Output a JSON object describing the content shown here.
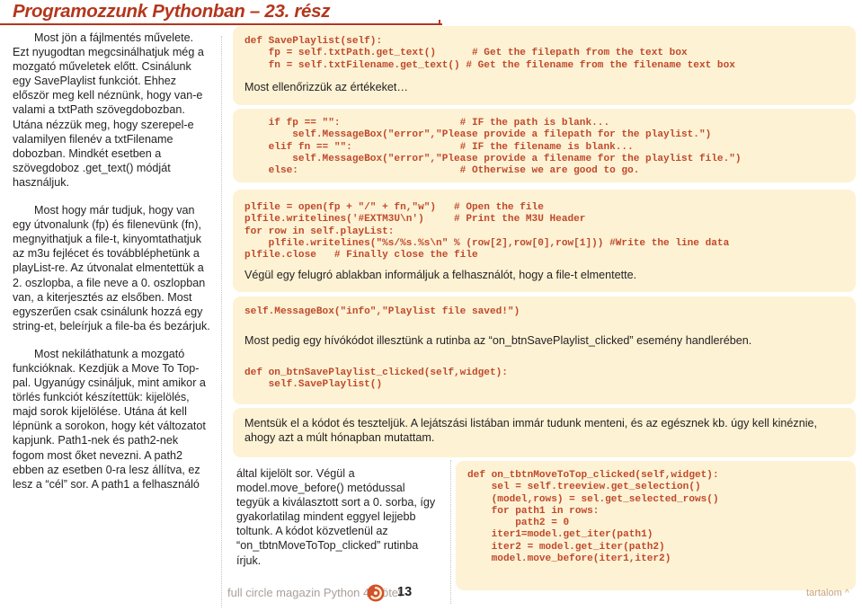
{
  "header": {
    "title": "Programozzunk Pythonban – 23. rész",
    "accent_color": "#b5361c"
  },
  "colors": {
    "code_panel_bg": "#fdf2d4",
    "code_text": "#c0492b",
    "body_text": "#231f20",
    "footer_muted": "#a9a19a",
    "toc_link": "#c9a27a"
  },
  "column_one": {
    "paragraphs": [
      "Most jön a fájlmentés művelete. Ezt nyugodtan megcsinálhatjuk még a mozgató műveletek előtt. Csinálunk egy SavePlaylist funkciót. Ehhez először meg kell néznünk, hogy van-e valami a txtPath szövegdobozban. Utána nézzük meg, hogy szerepel-e valamilyen filenév a txtFilename dobozban. Mindkét esetben a szövegdoboz .get_text() módját használjuk.",
      "Most hogy már tudjuk, hogy van egy útvonalunk (fp) és filenevünk (fn), megnyithatjuk a file-t, kinyomtathatjuk az m3u fejlécet és továbbléphetünk a playList-re. Az útvonalat elmentettük a 2. oszlopba, a file neve a 0. oszlopban van, a kiterjesztés az elsőben. Most egyszerűen csak csinálunk hozzá egy string-et, beleírjuk a file-ba és bezárjuk.",
      "Most nekiláthatunk a mozgató funkcióknak. Kezdjük a Move To Top-pal. Ugyanúgy csináljuk, mint amikor a törlés funkciót készítettük: kijelölés, majd sorok kijelölése. Utána át kell lépnünk a sorokon, hogy két változatot kapjunk. Path1-nek és path2-nek fogom most őket nevezni. A path2 ebben az esetben 0-ra lesz állítva, ez lesz a “cél” sor. A path1 a felhasználó"
    ]
  },
  "column_two": {
    "paragraph": "által kijelölt sor. Végül a model.move_before() metódussal tegyük a kiválasztott sort a 0. sorba, így gyakorlatilag mindent eggyel lejjebb toltunk. A kódot közvetlenül az “on_tbtnMoveToTop_clicked” rutinba írjuk."
  },
  "code_blocks": {
    "block1": "def SavePlaylist(self):\n    fp = self.txtPath.get_text()      # Get the filepath from the text box\n    fn = self.txtFilename.get_text() # Get the filename from the filename text box",
    "note1": "Most ellenőrizzük az értékeket…",
    "block2": "    if fp == \"\":                    # IF the path is blank...\n        self.MessageBox(\"error\",\"Please provide a filepath for the playlist.\")\n    elif fn == \"\":                  # IF the filename is blank...\n        self.MessageBox(\"error\",\"Please provide a filename for the playlist file.\")\n    else:                           # Otherwise we are good to go.",
    "block3": "plfile = open(fp + \"/\" + fn,\"w\")   # Open the file\nplfile.writelines('#EXTM3U\\n')     # Print the M3U Header\nfor row in self.playList:\n    plfile.writelines(\"%s/%s.%s\\n\" % (row[2],row[0],row[1])) #Write the line data\nplfile.close   # Finally close the file",
    "note2": "Végül egy felugró ablakban informáljuk a felhasználót, hogy a file-t elmentette.",
    "block4": "self.MessageBox(\"info\",\"Playlist file saved!\")",
    "note3": "Most pedig egy hívókódot illesztünk a rutinba az “on_btnSavePlaylist_clicked” esemény handlerében.",
    "block5": "def on_btnSavePlaylist_clicked(self,widget):\n    self.SavePlaylist()",
    "note4": "Mentsük el a kódot és teszteljük. A lejátszási listában immár tudunk menteni, és az egésznek kb. úgy kell kinéznie, ahogy azt a múlt hónapban mutattam.",
    "block6": "def on_tbtnMoveToTop_clicked(self,widget):\n    sel = self.treeview.get_selection()\n    (model,rows) = sel.get_selected_rows()\n    for path1 in rows:\n        path2 = 0\n    iter1=model.get_iter(path1)\n    iter2 = model.get_iter(path2)\n    model.move_before(iter1,iter2)"
  },
  "footer": {
    "magazine": "full circle magazin Python 4. kötet",
    "page_number": "13",
    "toc_label": "tartalom",
    "toc_caret": "^",
    "logo_name": "full-circle-logo"
  }
}
